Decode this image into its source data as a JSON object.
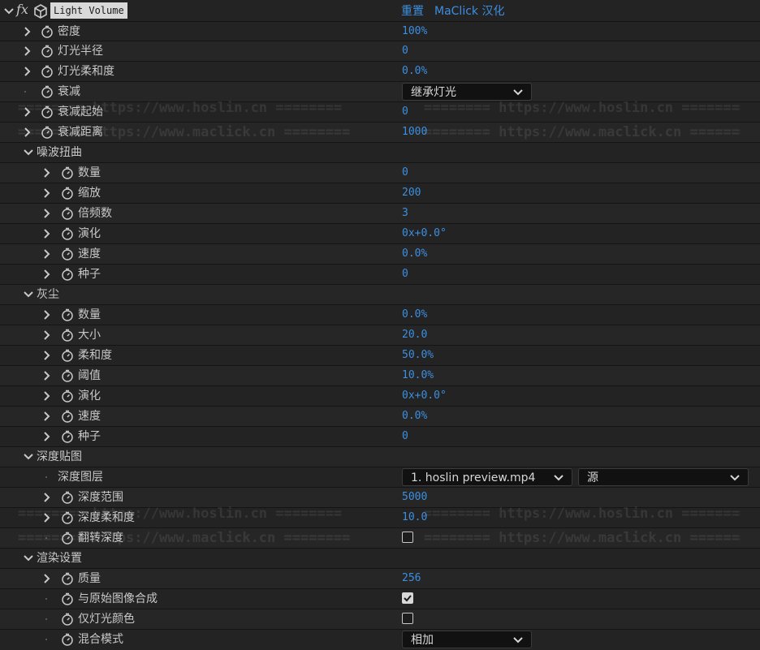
{
  "header": {
    "effect_name": "Light Volume",
    "reset_label": "重置",
    "credit_label": "MaClick 汉化"
  },
  "watermarks": {
    "hoslin": "======== https://www.hoslin.cn ========",
    "maclick": "======== https://www.maclick.cn ========"
  },
  "params": {
    "density": {
      "label": "密度",
      "value": "100%"
    },
    "light_radius": {
      "label": "灯光半径",
      "value": "0"
    },
    "light_softness": {
      "label": "灯光柔和度",
      "value": "0.0%"
    },
    "falloff": {
      "label": "衰减",
      "value": "继承灯光"
    },
    "falloff_start": {
      "label": "衰减起始",
      "value": "0"
    },
    "falloff_distance": {
      "label": "衰减距离",
      "value": "1000"
    },
    "noise_group": {
      "label": "噪波扭曲"
    },
    "noise_amount": {
      "label": "数量",
      "value": "0"
    },
    "noise_scale": {
      "label": "缩放",
      "value": "200"
    },
    "noise_octaves": {
      "label": "倍频数",
      "value": "3"
    },
    "noise_evolution": {
      "label": "演化",
      "value": "0x+0.0°"
    },
    "noise_speed": {
      "label": "速度",
      "value": "0.0%"
    },
    "noise_seed": {
      "label": "种子",
      "value": "0"
    },
    "dust_group": {
      "label": "灰尘"
    },
    "dust_amount": {
      "label": "数量",
      "value": "0.0%"
    },
    "dust_size": {
      "label": "大小",
      "value": "20.0"
    },
    "dust_softness": {
      "label": "柔和度",
      "value": "50.0%"
    },
    "dust_threshold": {
      "label": "阈值",
      "value": "10.0%"
    },
    "dust_evolution": {
      "label": "演化",
      "value": "0x+0.0°"
    },
    "dust_speed": {
      "label": "速度",
      "value": "0.0%"
    },
    "dust_seed": {
      "label": "种子",
      "value": "0"
    },
    "depth_group": {
      "label": "深度贴图"
    },
    "depth_layer": {
      "label": "深度图层",
      "value": "1. hoslin preview.mp4",
      "source": "源"
    },
    "depth_range": {
      "label": "深度范围",
      "value": "5000"
    },
    "depth_softness": {
      "label": "深度柔和度",
      "value": "10.0"
    },
    "invert_depth": {
      "label": "翻转深度",
      "checked": false
    },
    "render_group": {
      "label": "渲染设置"
    },
    "quality": {
      "label": "质量",
      "value": "256"
    },
    "composite_original": {
      "label": "与原始图像合成",
      "checked": true
    },
    "light_color_only": {
      "label": "仅灯光颜色",
      "checked": false
    },
    "blend_mode": {
      "label": "混合模式",
      "value": "相加"
    }
  }
}
